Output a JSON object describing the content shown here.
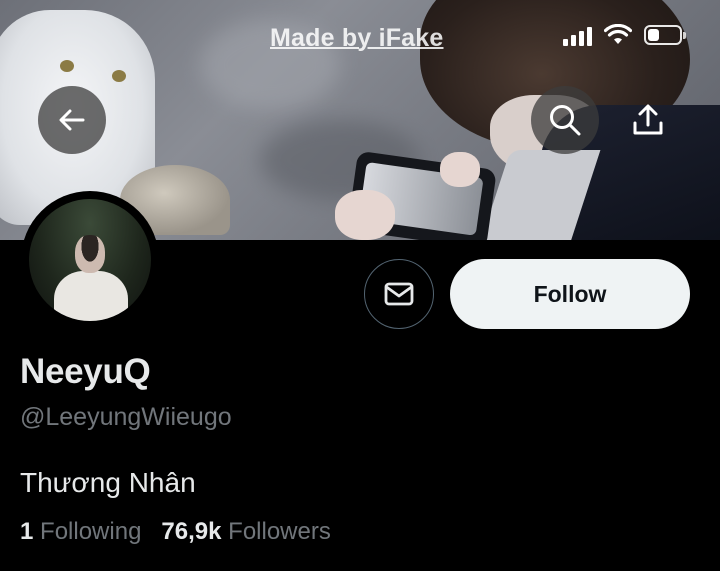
{
  "watermark": "Made by iFake",
  "status_bar": {
    "signal_icon": "cellular-signal-icon",
    "wifi_icon": "wifi-icon",
    "battery_icon": "battery-icon",
    "battery_level": 0.35
  },
  "header": {
    "back_icon": "arrow-left-icon",
    "search_icon": "search-icon",
    "share_icon": "share-icon"
  },
  "actions": {
    "message_icon": "envelope-icon",
    "follow_label": "Follow"
  },
  "profile": {
    "display_name": "NeeyuQ",
    "handle": "@LeeyungWiieugo",
    "bio": "Thương Nhân",
    "following_count": "1",
    "following_label": "Following",
    "followers_count": "76,9k",
    "followers_label": "Followers"
  },
  "colors": {
    "background": "#000000",
    "primary_text": "#e7e9ea",
    "secondary_text": "#71767b",
    "follow_button_bg": "#eff3f4",
    "follow_button_text": "#0f1419"
  }
}
